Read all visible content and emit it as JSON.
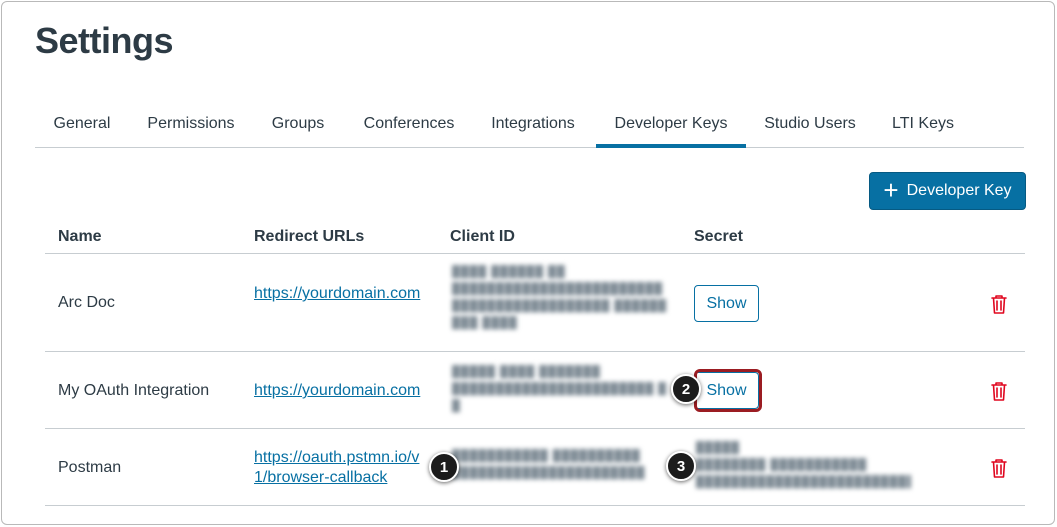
{
  "page": {
    "title": "Settings"
  },
  "tabs": [
    {
      "label": "General"
    },
    {
      "label": "Permissions"
    },
    {
      "label": "Groups"
    },
    {
      "label": "Conferences"
    },
    {
      "label": "Integrations"
    },
    {
      "label": "Developer Keys",
      "active": true
    },
    {
      "label": "Studio Users"
    },
    {
      "label": "LTI Keys"
    }
  ],
  "toolbar": {
    "add_label": "Developer Key",
    "add_icon": "plus-icon"
  },
  "table": {
    "headers": {
      "name": "Name",
      "redirect": "Redirect URLs",
      "client_id": "Client ID",
      "secret": "Secret"
    },
    "rows": [
      {
        "name": "Arc Doc",
        "redirect": "https://yourdomain.com",
        "secret_button": "Show",
        "delete_icon": "trash-icon"
      },
      {
        "name": "My OAuth Integration",
        "redirect": "https://yourdomain.com",
        "secret_button": "Show",
        "delete_icon": "trash-icon"
      },
      {
        "name": "Postman",
        "redirect_line1": "https://oauth.pstmn.io/v",
        "redirect_line2": "1/browser-callback",
        "delete_icon": "trash-icon"
      }
    ]
  },
  "callouts": [
    "1",
    "2",
    "3"
  ],
  "colors": {
    "accent": "#0770a3",
    "highlight": "#9b1c22",
    "danger": "#e0061f",
    "text": "#2d3b45"
  }
}
